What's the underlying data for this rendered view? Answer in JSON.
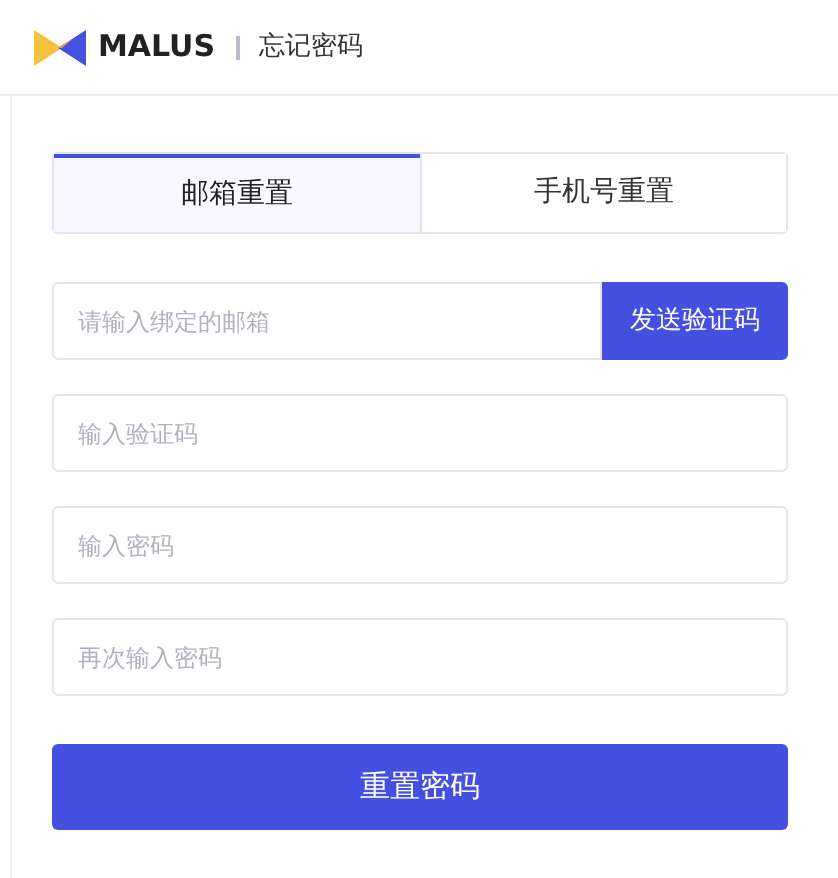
{
  "header": {
    "brand": "MALUS",
    "page_title": "忘记密码"
  },
  "tabs": [
    {
      "label": "邮箱重置",
      "selected": true
    },
    {
      "label": "手机号重置",
      "selected": false
    }
  ],
  "email_field": {
    "placeholder": "请输入绑定的邮箱",
    "send_button": "发送验证码"
  },
  "fields": [
    {
      "placeholder": "输入验证码"
    },
    {
      "placeholder": "输入密码"
    },
    {
      "placeholder": "再次输入密码"
    }
  ],
  "submit_button": "重置密码"
}
